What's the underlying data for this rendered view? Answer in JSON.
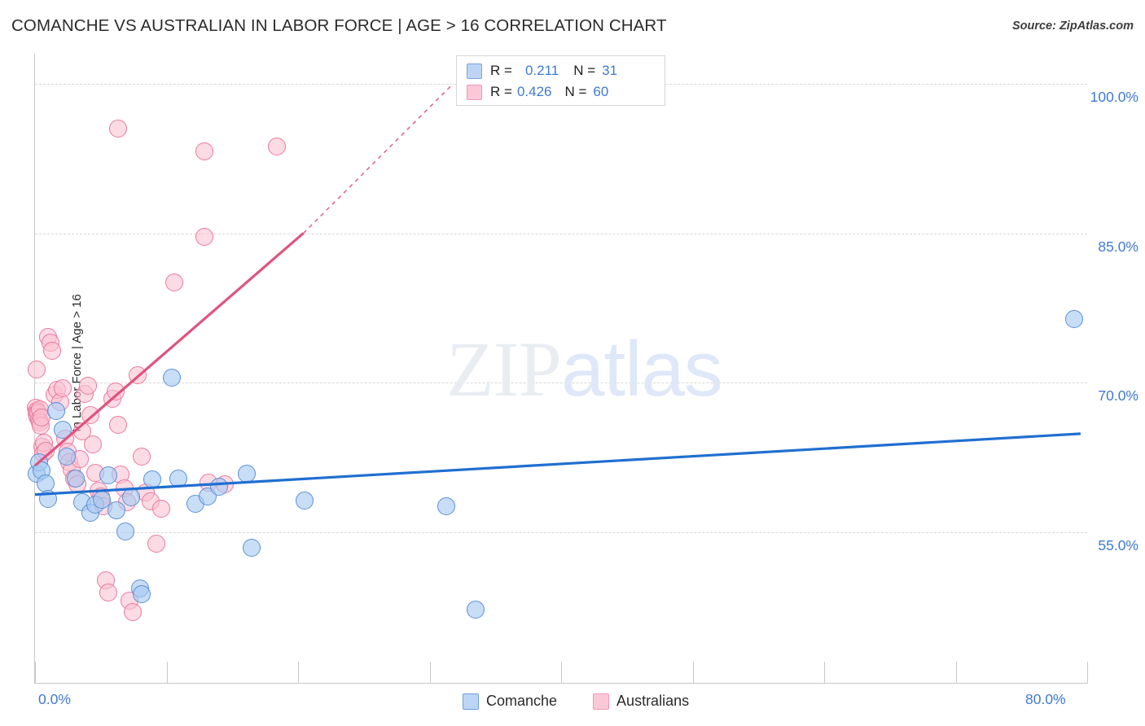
{
  "header": {
    "title": "COMANCHE VS AUSTRALIAN IN LABOR FORCE | AGE > 16 CORRELATION CHART",
    "source": "Source: ZipAtlas.com"
  },
  "stats": {
    "rows": [
      {
        "series": "Comanche",
        "r_label": "R =",
        "r_value": "0.211",
        "n_label": "N =",
        "n_value": "31",
        "color": "#bcd4f5"
      },
      {
        "series": "Australians",
        "r_label": "R =",
        "r_value": "0.426",
        "n_label": "N =",
        "n_value": "60",
        "color": "#fbc8d8"
      }
    ]
  },
  "legend": {
    "items": [
      {
        "label": "Comanche",
        "color": "#bcd4f5"
      },
      {
        "label": "Australians",
        "color": "#fbc8d8"
      }
    ]
  },
  "watermark": {
    "part1": "ZIP",
    "part2": "atlas"
  },
  "chart_data": {
    "type": "scatter",
    "title": "COMANCHE VS AUSTRALIAN IN LABOR FORCE | AGE > 16 CORRELATION CHART",
    "xlabel": "",
    "ylabel": "In Labor Force | Age > 16",
    "xlim": [
      0.0,
      80.0
    ],
    "ylim": [
      40.0,
      103.0
    ],
    "grid": true,
    "legend_position": "bottom-center",
    "x_ticks": [
      {
        "value": 0.0,
        "label": "0.0%"
      },
      {
        "value": 10.0,
        "label": ""
      },
      {
        "value": 20.0,
        "label": ""
      },
      {
        "value": 30.0,
        "label": ""
      },
      {
        "value": 40.0,
        "label": ""
      },
      {
        "value": 50.0,
        "label": ""
      },
      {
        "value": 60.0,
        "label": ""
      },
      {
        "value": 70.0,
        "label": ""
      },
      {
        "value": 80.0,
        "label": "80.0%"
      }
    ],
    "y_ticks": [
      {
        "value": 100.0,
        "label": "100.0%"
      },
      {
        "value": 85.0,
        "label": "85.0%"
      },
      {
        "value": 70.0,
        "label": "70.0%"
      },
      {
        "value": 55.0,
        "label": "55.0%"
      }
    ],
    "series": [
      {
        "name": "Comanche",
        "color": "#a7caf2",
        "edge_color": "#5b8fd4",
        "r": 0.211,
        "n": 31,
        "trendline": {
          "x0": 0.0,
          "y0": 58.8,
          "x1": 79.5,
          "y1": 64.9,
          "style": "solid",
          "color": "#1f6fd0"
        },
        "points": [
          [
            0.1,
            60.9
          ],
          [
            0.3,
            62.0
          ],
          [
            0.5,
            61.2
          ],
          [
            0.8,
            59.9
          ],
          [
            1.0,
            58.4
          ],
          [
            1.6,
            67.2
          ],
          [
            2.1,
            65.3
          ],
          [
            2.4,
            62.6
          ],
          [
            3.1,
            60.4
          ],
          [
            3.6,
            58.0
          ],
          [
            4.2,
            57.0
          ],
          [
            4.6,
            57.8
          ],
          [
            5.1,
            58.3
          ],
          [
            5.6,
            60.7
          ],
          [
            6.2,
            57.2
          ],
          [
            6.9,
            55.1
          ],
          [
            7.3,
            58.5
          ],
          [
            8.0,
            49.4
          ],
          [
            8.1,
            48.8
          ],
          [
            8.9,
            60.3
          ],
          [
            10.4,
            70.5
          ],
          [
            10.9,
            60.4
          ],
          [
            12.2,
            57.9
          ],
          [
            13.1,
            58.6
          ],
          [
            14.0,
            59.6
          ],
          [
            16.1,
            60.9
          ],
          [
            16.5,
            53.5
          ],
          [
            20.5,
            58.2
          ],
          [
            31.3,
            57.6
          ],
          [
            33.5,
            47.3
          ],
          [
            79.0,
            76.4
          ]
        ]
      },
      {
        "name": "Australians",
        "color": "#fac1d3",
        "edge_color": "#e8799e",
        "r": 0.426,
        "n": 60,
        "trendline": {
          "x0": 0.0,
          "y0": 61.7,
          "x1": 20.4,
          "y1": 85.0,
          "style": "solid",
          "color": "#e0537f",
          "dashed_extension": {
            "x1": 31.8,
            "y1": 100.0
          }
        },
        "points": [
          [
            0.05,
            67.5
          ],
          [
            0.1,
            67.2
          ],
          [
            0.15,
            66.9
          ],
          [
            0.2,
            66.6
          ],
          [
            0.25,
            67.0
          ],
          [
            0.3,
            66.3
          ],
          [
            0.35,
            67.3
          ],
          [
            0.4,
            66.0
          ],
          [
            0.45,
            65.7
          ],
          [
            0.5,
            66.5
          ],
          [
            0.1,
            71.3
          ],
          [
            0.55,
            63.6
          ],
          [
            0.6,
            62.9
          ],
          [
            0.7,
            64.0
          ],
          [
            0.8,
            63.2
          ],
          [
            1.0,
            74.6
          ],
          [
            1.2,
            74.0
          ],
          [
            1.3,
            73.2
          ],
          [
            1.5,
            68.8
          ],
          [
            1.7,
            69.3
          ],
          [
            1.9,
            68.1
          ],
          [
            2.1,
            69.5
          ],
          [
            2.3,
            64.4
          ],
          [
            2.5,
            63.1
          ],
          [
            2.6,
            62.0
          ],
          [
            2.8,
            61.3
          ],
          [
            3.0,
            60.4
          ],
          [
            3.2,
            59.8
          ],
          [
            3.4,
            62.4
          ],
          [
            3.6,
            65.1
          ],
          [
            3.8,
            68.9
          ],
          [
            4.0,
            69.7
          ],
          [
            4.2,
            66.8
          ],
          [
            4.4,
            63.8
          ],
          [
            4.6,
            61.0
          ],
          [
            4.8,
            59.2
          ],
          [
            5.0,
            58.6
          ],
          [
            5.2,
            57.6
          ],
          [
            5.4,
            50.2
          ],
          [
            5.6,
            49.0
          ],
          [
            5.9,
            68.4
          ],
          [
            6.1,
            69.1
          ],
          [
            6.3,
            65.8
          ],
          [
            6.5,
            60.8
          ],
          [
            6.8,
            59.4
          ],
          [
            7.0,
            58.0
          ],
          [
            7.2,
            48.2
          ],
          [
            7.4,
            47.0
          ],
          [
            7.8,
            70.8
          ],
          [
            8.1,
            62.6
          ],
          [
            8.4,
            59.0
          ],
          [
            8.8,
            58.1
          ],
          [
            9.2,
            53.9
          ],
          [
            9.6,
            57.4
          ],
          [
            10.6,
            80.1
          ],
          [
            12.9,
            84.6
          ],
          [
            13.2,
            60.0
          ],
          [
            14.4,
            59.8
          ],
          [
            6.3,
            95.5
          ],
          [
            12.9,
            93.2
          ],
          [
            18.4,
            93.7
          ]
        ]
      }
    ]
  }
}
